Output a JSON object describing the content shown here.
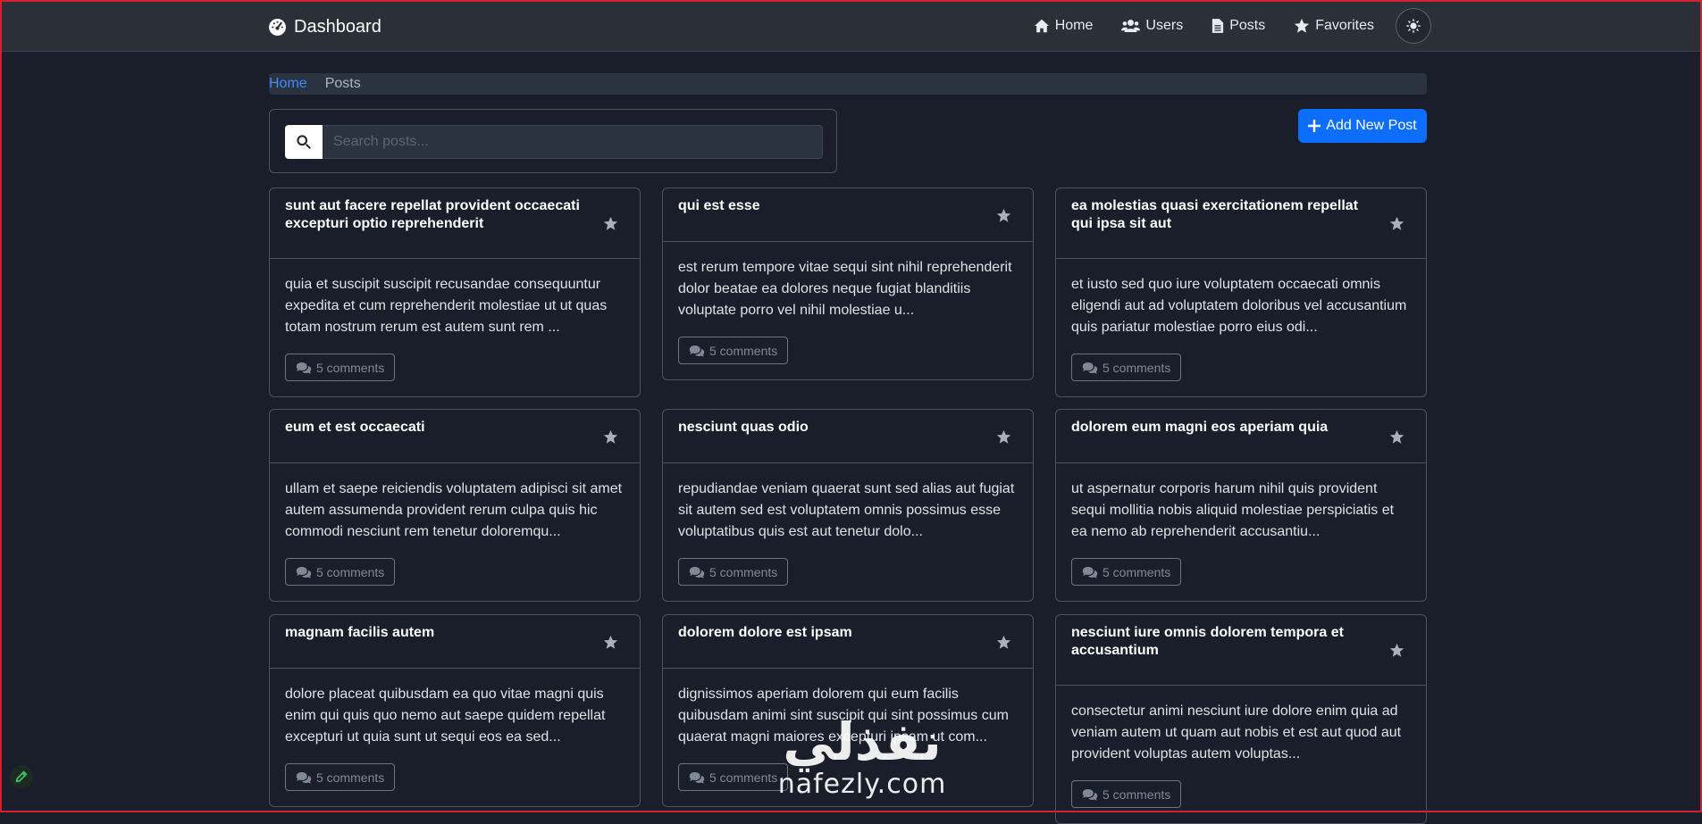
{
  "navbar": {
    "brand": "Dashboard",
    "links": [
      {
        "label": "Home",
        "icon": "home-icon"
      },
      {
        "label": "Users",
        "icon": "users-icon"
      },
      {
        "label": "Posts",
        "icon": "file-icon"
      },
      {
        "label": "Favorites",
        "icon": "star-icon"
      }
    ],
    "theme_icon": "sun-icon"
  },
  "breadcrumb": {
    "home": "Home",
    "current": "Posts"
  },
  "search": {
    "placeholder": "Search posts...",
    "value": ""
  },
  "add_button": "Add New Post",
  "posts": [
    {
      "title": "sunt aut facere repellat provident occaecati excepturi optio reprehenderit",
      "body": "quia et suscipit suscipit recusandae consequuntur expedita et cum reprehenderit molestiae ut ut quas totam nostrum rerum est autem sunt rem ...",
      "comments": "5 comments"
    },
    {
      "title": "qui est esse",
      "body": "est rerum tempore vitae sequi sint nihil reprehenderit dolor beatae ea dolores neque fugiat blanditiis voluptate porro vel nihil molestiae u...",
      "comments": "5 comments"
    },
    {
      "title": "ea molestias quasi exercitationem repellat qui ipsa sit aut",
      "body": "et iusto sed quo iure voluptatem occaecati omnis eligendi aut ad voluptatem doloribus vel accusantium quis pariatur molestiae porro eius odi...",
      "comments": "5 comments"
    },
    {
      "title": "eum et est occaecati",
      "body": "ullam et saepe reiciendis voluptatem adipisci sit amet autem assumenda provident rerum culpa quis hic commodi nesciunt rem tenetur doloremqu...",
      "comments": "5 comments"
    },
    {
      "title": "nesciunt quas odio",
      "body": "repudiandae veniam quaerat sunt sed alias aut fugiat sit autem sed est voluptatem omnis possimus esse voluptatibus quis est aut tenetur dolo...",
      "comments": "5 comments"
    },
    {
      "title": "dolorem eum magni eos aperiam quia",
      "body": "ut aspernatur corporis harum nihil quis provident sequi mollitia nobis aliquid molestiae perspiciatis et ea nemo ab reprehenderit accusantiu...",
      "comments": "5 comments"
    },
    {
      "title": "magnam facilis autem",
      "body": "dolore placeat quibusdam ea quo vitae magni quis enim qui quis quo nemo aut saepe quidem repellat excepturi ut quia sunt ut sequi eos ea sed...",
      "comments": "5 comments"
    },
    {
      "title": "dolorem dolore est ipsam",
      "body": "dignissimos aperiam dolorem qui eum facilis quibusdam animi sint suscipit qui sint possimus cum quaerat magni maiores excepturi ipsam ut com...",
      "comments": "5 comments"
    },
    {
      "title": "nesciunt iure omnis dolorem tempora et accusantium",
      "body": "consectetur animi nesciunt iure dolore enim quia ad veniam autem ut quam aut nobis et est aut quod aut provident voluptas autem voluptas...",
      "comments": "5 comments"
    }
  ],
  "watermark": {
    "arabic": "نفذلي",
    "latin": "nafezly.com"
  },
  "colors": {
    "accent": "#0d6efd",
    "background": "#1a1e2a",
    "navbar": "#2b3038",
    "border": "#4a5160"
  }
}
